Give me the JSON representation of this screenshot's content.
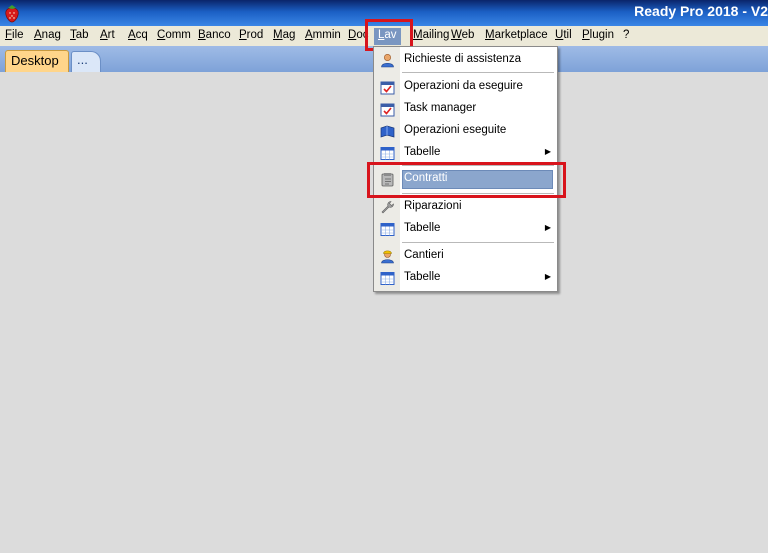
{
  "window": {
    "title": "Ready Pro 2018 - V2"
  },
  "menubar": {
    "items": [
      "File",
      "Anag",
      "Tab",
      "Art",
      "Acq",
      "Comm",
      "Banco",
      "Prod",
      "Mag",
      "Ammin",
      "Doc",
      "Lav",
      "Mailing",
      "Web",
      "Marketplace",
      "Util",
      "Plugin",
      "?"
    ],
    "active": "Lav"
  },
  "tabs": [
    {
      "label": "Desktop",
      "selected": true
    },
    {
      "label": "..."
    }
  ],
  "dropdown": {
    "items": [
      {
        "label": "Richieste di assistenza",
        "icon": "user-icon"
      },
      {
        "label": "Operazioni da eseguire",
        "icon": "calendar-task-icon"
      },
      {
        "label": "Task manager",
        "icon": "calendar-task-icon"
      },
      {
        "label": "Operazioni eseguite",
        "icon": "book-icon"
      },
      {
        "label": "Tabelle",
        "icon": "table-icon",
        "submenu": true
      },
      {
        "label": "Contratti",
        "icon": "contract-icon",
        "highlighted": true
      },
      {
        "label": "Riparazioni",
        "icon": "wrench-icon"
      },
      {
        "label": "Tabelle",
        "icon": "table-icon",
        "submenu": true
      },
      {
        "label": "Cantieri",
        "icon": "worker-icon"
      },
      {
        "label": "Tabelle",
        "icon": "table-icon",
        "submenu": true
      }
    ]
  },
  "colors": {
    "title_bar": "#1b5fc4",
    "menu_highlight": "#7a96c1",
    "annotation_red": "#d8141c",
    "desktop_background": "#dcdcdc"
  }
}
